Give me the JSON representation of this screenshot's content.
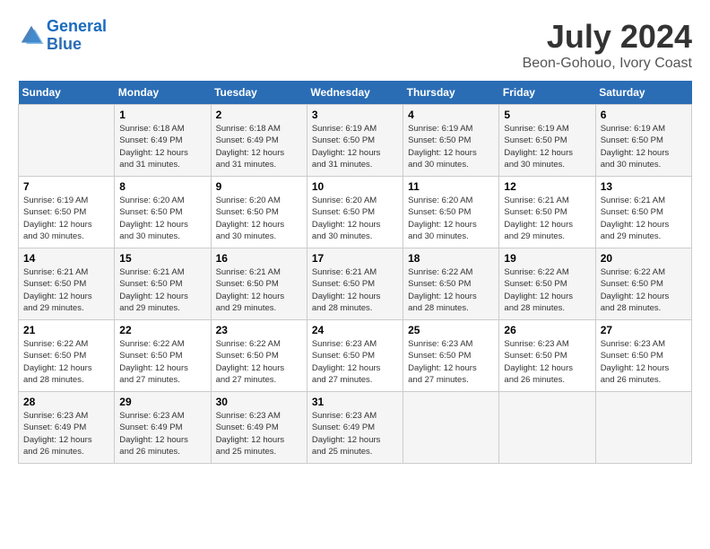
{
  "logo": {
    "text_general": "General",
    "text_blue": "Blue"
  },
  "header": {
    "month_title": "July 2024",
    "location": "Beon-Gohouo, Ivory Coast"
  },
  "columns": [
    "Sunday",
    "Monday",
    "Tuesday",
    "Wednesday",
    "Thursday",
    "Friday",
    "Saturday"
  ],
  "weeks": [
    [
      {
        "day": "",
        "info": ""
      },
      {
        "day": "1",
        "info": "Sunrise: 6:18 AM\nSunset: 6:49 PM\nDaylight: 12 hours\nand 31 minutes."
      },
      {
        "day": "2",
        "info": "Sunrise: 6:18 AM\nSunset: 6:49 PM\nDaylight: 12 hours\nand 31 minutes."
      },
      {
        "day": "3",
        "info": "Sunrise: 6:19 AM\nSunset: 6:50 PM\nDaylight: 12 hours\nand 31 minutes."
      },
      {
        "day": "4",
        "info": "Sunrise: 6:19 AM\nSunset: 6:50 PM\nDaylight: 12 hours\nand 30 minutes."
      },
      {
        "day": "5",
        "info": "Sunrise: 6:19 AM\nSunset: 6:50 PM\nDaylight: 12 hours\nand 30 minutes."
      },
      {
        "day": "6",
        "info": "Sunrise: 6:19 AM\nSunset: 6:50 PM\nDaylight: 12 hours\nand 30 minutes."
      }
    ],
    [
      {
        "day": "7",
        "info": "Sunrise: 6:19 AM\nSunset: 6:50 PM\nDaylight: 12 hours\nand 30 minutes."
      },
      {
        "day": "8",
        "info": "Sunrise: 6:20 AM\nSunset: 6:50 PM\nDaylight: 12 hours\nand 30 minutes."
      },
      {
        "day": "9",
        "info": "Sunrise: 6:20 AM\nSunset: 6:50 PM\nDaylight: 12 hours\nand 30 minutes."
      },
      {
        "day": "10",
        "info": "Sunrise: 6:20 AM\nSunset: 6:50 PM\nDaylight: 12 hours\nand 30 minutes."
      },
      {
        "day": "11",
        "info": "Sunrise: 6:20 AM\nSunset: 6:50 PM\nDaylight: 12 hours\nand 30 minutes."
      },
      {
        "day": "12",
        "info": "Sunrise: 6:21 AM\nSunset: 6:50 PM\nDaylight: 12 hours\nand 29 minutes."
      },
      {
        "day": "13",
        "info": "Sunrise: 6:21 AM\nSunset: 6:50 PM\nDaylight: 12 hours\nand 29 minutes."
      }
    ],
    [
      {
        "day": "14",
        "info": "Sunrise: 6:21 AM\nSunset: 6:50 PM\nDaylight: 12 hours\nand 29 minutes."
      },
      {
        "day": "15",
        "info": "Sunrise: 6:21 AM\nSunset: 6:50 PM\nDaylight: 12 hours\nand 29 minutes."
      },
      {
        "day": "16",
        "info": "Sunrise: 6:21 AM\nSunset: 6:50 PM\nDaylight: 12 hours\nand 29 minutes."
      },
      {
        "day": "17",
        "info": "Sunrise: 6:21 AM\nSunset: 6:50 PM\nDaylight: 12 hours\nand 28 minutes."
      },
      {
        "day": "18",
        "info": "Sunrise: 6:22 AM\nSunset: 6:50 PM\nDaylight: 12 hours\nand 28 minutes."
      },
      {
        "day": "19",
        "info": "Sunrise: 6:22 AM\nSunset: 6:50 PM\nDaylight: 12 hours\nand 28 minutes."
      },
      {
        "day": "20",
        "info": "Sunrise: 6:22 AM\nSunset: 6:50 PM\nDaylight: 12 hours\nand 28 minutes."
      }
    ],
    [
      {
        "day": "21",
        "info": "Sunrise: 6:22 AM\nSunset: 6:50 PM\nDaylight: 12 hours\nand 28 minutes."
      },
      {
        "day": "22",
        "info": "Sunrise: 6:22 AM\nSunset: 6:50 PM\nDaylight: 12 hours\nand 27 minutes."
      },
      {
        "day": "23",
        "info": "Sunrise: 6:22 AM\nSunset: 6:50 PM\nDaylight: 12 hours\nand 27 minutes."
      },
      {
        "day": "24",
        "info": "Sunrise: 6:23 AM\nSunset: 6:50 PM\nDaylight: 12 hours\nand 27 minutes."
      },
      {
        "day": "25",
        "info": "Sunrise: 6:23 AM\nSunset: 6:50 PM\nDaylight: 12 hours\nand 27 minutes."
      },
      {
        "day": "26",
        "info": "Sunrise: 6:23 AM\nSunset: 6:50 PM\nDaylight: 12 hours\nand 26 minutes."
      },
      {
        "day": "27",
        "info": "Sunrise: 6:23 AM\nSunset: 6:50 PM\nDaylight: 12 hours\nand 26 minutes."
      }
    ],
    [
      {
        "day": "28",
        "info": "Sunrise: 6:23 AM\nSunset: 6:49 PM\nDaylight: 12 hours\nand 26 minutes."
      },
      {
        "day": "29",
        "info": "Sunrise: 6:23 AM\nSunset: 6:49 PM\nDaylight: 12 hours\nand 26 minutes."
      },
      {
        "day": "30",
        "info": "Sunrise: 6:23 AM\nSunset: 6:49 PM\nDaylight: 12 hours\nand 25 minutes."
      },
      {
        "day": "31",
        "info": "Sunrise: 6:23 AM\nSunset: 6:49 PM\nDaylight: 12 hours\nand 25 minutes."
      },
      {
        "day": "",
        "info": ""
      },
      {
        "day": "",
        "info": ""
      },
      {
        "day": "",
        "info": ""
      }
    ]
  ]
}
